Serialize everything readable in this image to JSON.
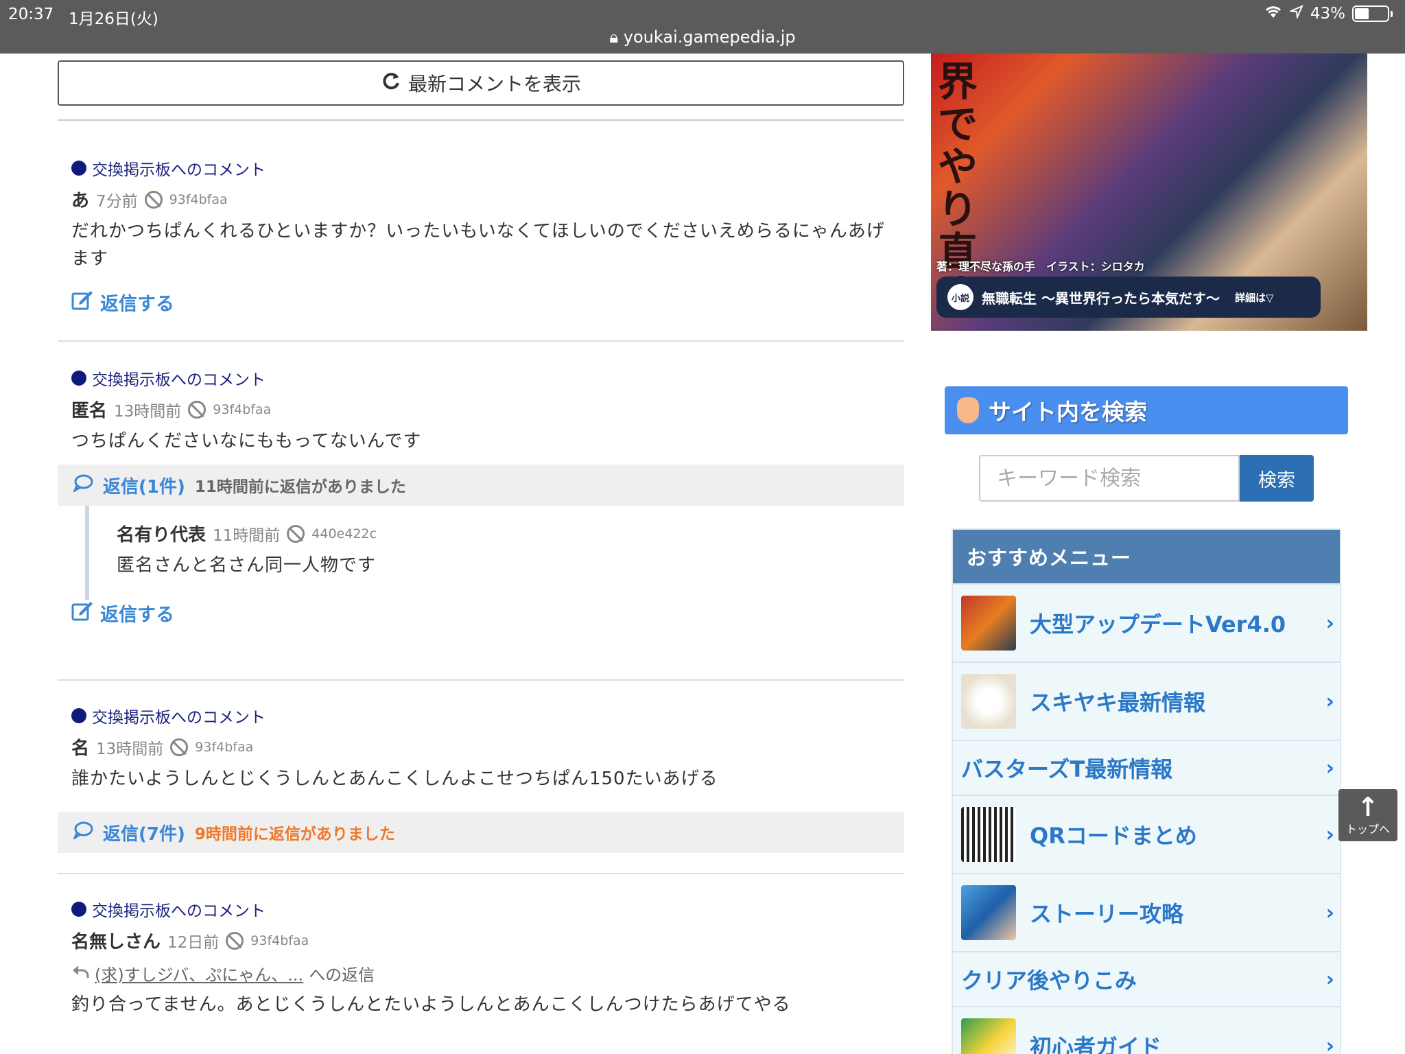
{
  "status": {
    "time": "20:37",
    "date": "1月26日(火)",
    "battery": "43%",
    "url": "youkai.gamepedia.jp"
  },
  "latest_button": "最新コメントを表示",
  "board_label": "交換掲示板へのコメント",
  "reply_label": "返信する",
  "comments": [
    {
      "author": "あ",
      "ago": "7分前",
      "hash": "93f4bfaa",
      "text": "だれかつちぱんくれるひといますか？いったいもいなくてほしいのでくださいえめらるにゃんあげます"
    },
    {
      "author": "匿名",
      "ago": "13時間前",
      "hash": "93f4bfaa",
      "text": "つちぱんくださいなにももってないんです",
      "reply_count": "返信(1件)",
      "reply_note": "11時間前に返信がありました",
      "nested": {
        "author": "名有り代表",
        "ago": "11時間前",
        "hash": "440e422c",
        "text": "匿名さんと名さん同一人物です"
      }
    },
    {
      "author": "名",
      "ago": "13時間前",
      "hash": "93f4bfaa",
      "text": "誰かたいようしんとじくうしんとあんこくしんよこせつちぱん150たいあげる",
      "reply_count": "返信(7件)",
      "reply_note": "9時間前に返信がありました"
    },
    {
      "author": "名無しさん",
      "ago": "12日前",
      "hash": "93f4bfaa",
      "quote_link": "(求)すしジバ、ぷにゃん、...",
      "quote_suffix": "への返信",
      "text": "釣り合ってません。あとじくうしんとたいようしんとあんこくしんつけたらあげてやる"
    }
  ],
  "banner": {
    "vertical_text": "界でやり直す！",
    "credit": "著：理不尽な孫の手　イラスト：シロタカ",
    "badge": "小説",
    "title": "無職転生 ～異世界行ったら本気だす～",
    "more": "詳細は▽"
  },
  "search": {
    "title": "サイト内を検索",
    "placeholder": "キーワード検索",
    "button": "検索"
  },
  "menu": {
    "heading": "おすすめメニュー",
    "items": [
      "大型アップデートVer4.0",
      "スキヤキ最新情報",
      "バスターズT最新情報",
      "QRコードまとめ",
      "ストーリー攻略",
      "クリア後やりこみ",
      "初心者ガイド"
    ]
  },
  "to_top": {
    "arrow": "↑",
    "label": "トップへ"
  },
  "colors": {
    "link_blue": "#3a87d6",
    "board_navy": "#1a237e",
    "note_orange": "#f07828",
    "menu_head": "#4f7fb0",
    "search_bar": "#4a8ef0"
  }
}
